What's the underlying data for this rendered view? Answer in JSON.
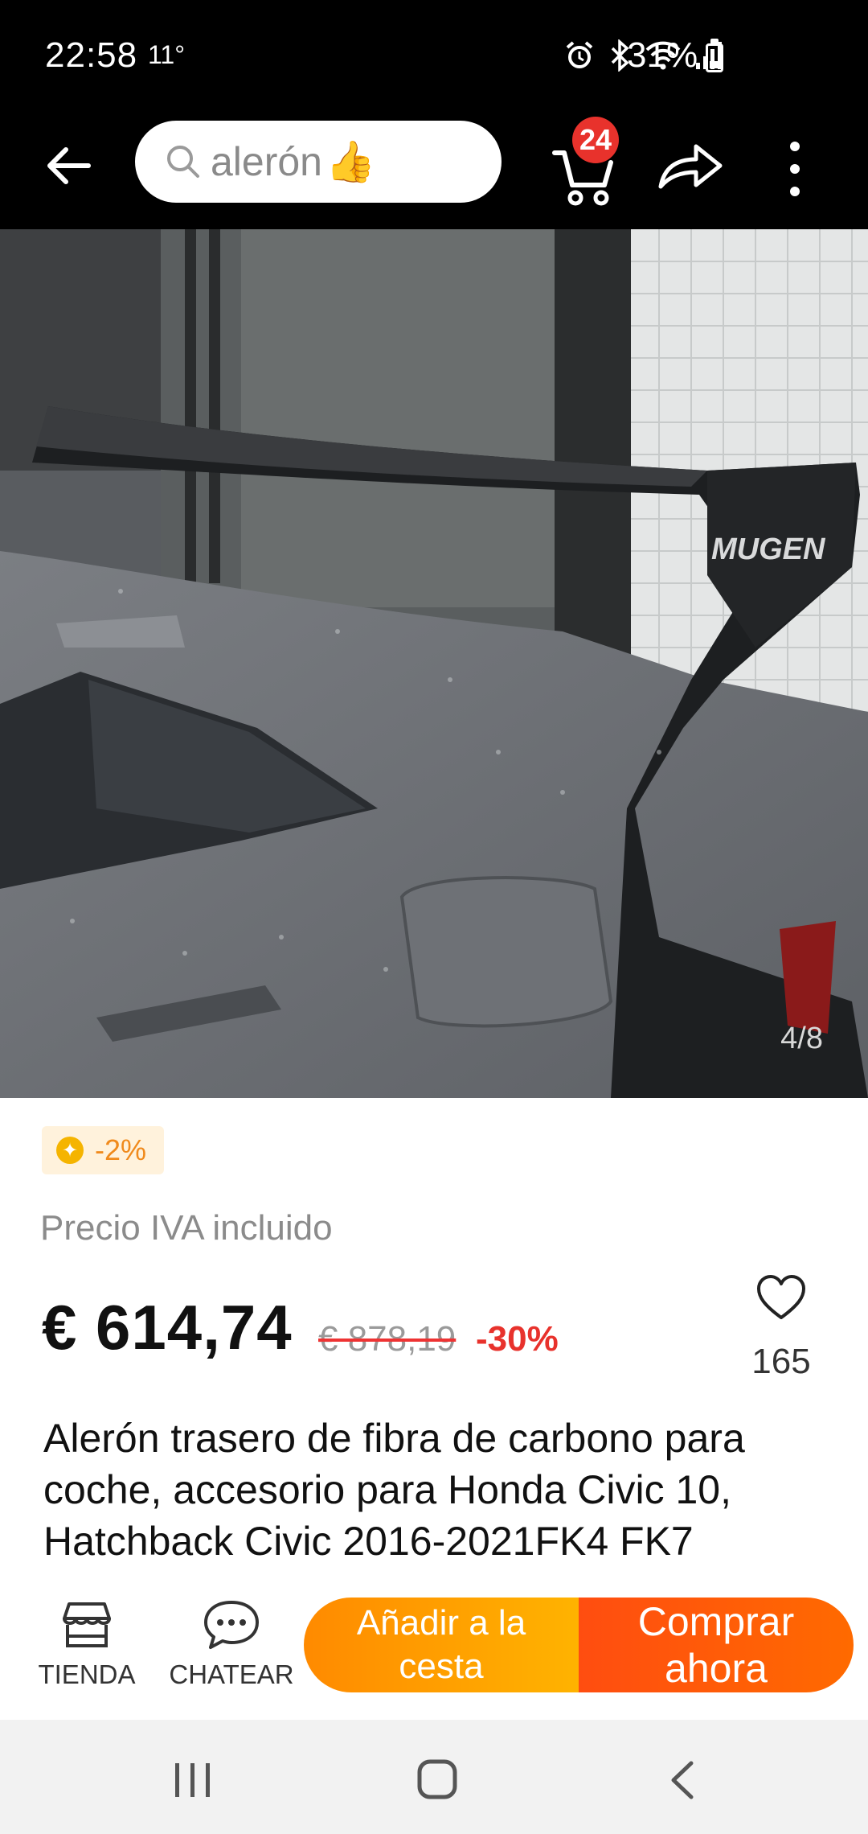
{
  "status_bar": {
    "time": "22:58",
    "temperature": "11°",
    "battery": "31%",
    "battery_level": 0.31,
    "icons": [
      "alarm-icon",
      "bluetooth-icon",
      "wifi-icon",
      "signal-icon",
      "battery-icon"
    ]
  },
  "header": {
    "search_text": "alerón",
    "search_emoji": "👍",
    "cart_count": "24",
    "icons": [
      "back-arrow-icon",
      "search-icon",
      "cart-icon",
      "share-icon",
      "more-vert-icon"
    ]
  },
  "gallery": {
    "counter": "4/8",
    "brand_on_image": "MUGEN"
  },
  "product": {
    "coupon": "-2%",
    "tax_note": "Precio IVA incluido",
    "price": "€ 614,74",
    "old_price": "€ 878,19",
    "discount": "-30%",
    "favorites": "165",
    "title": "Alerón trasero de fibra de carbono para coche, accesorio para Honda Civic 10, Hatchback Civic 2016-2021FK4 FK7"
  },
  "actions": {
    "store_label": "TIENDA",
    "chat_label": "CHATEAR",
    "add_to_cart_label": "Añadir a la cesta",
    "buy_now_label": "Comprar ahora"
  },
  "colors": {
    "discount_red": "#e8322c",
    "cart_orange": "#ff9a00",
    "buy_orange": "#ff5a10",
    "coupon_bg": "#fff2dc"
  }
}
